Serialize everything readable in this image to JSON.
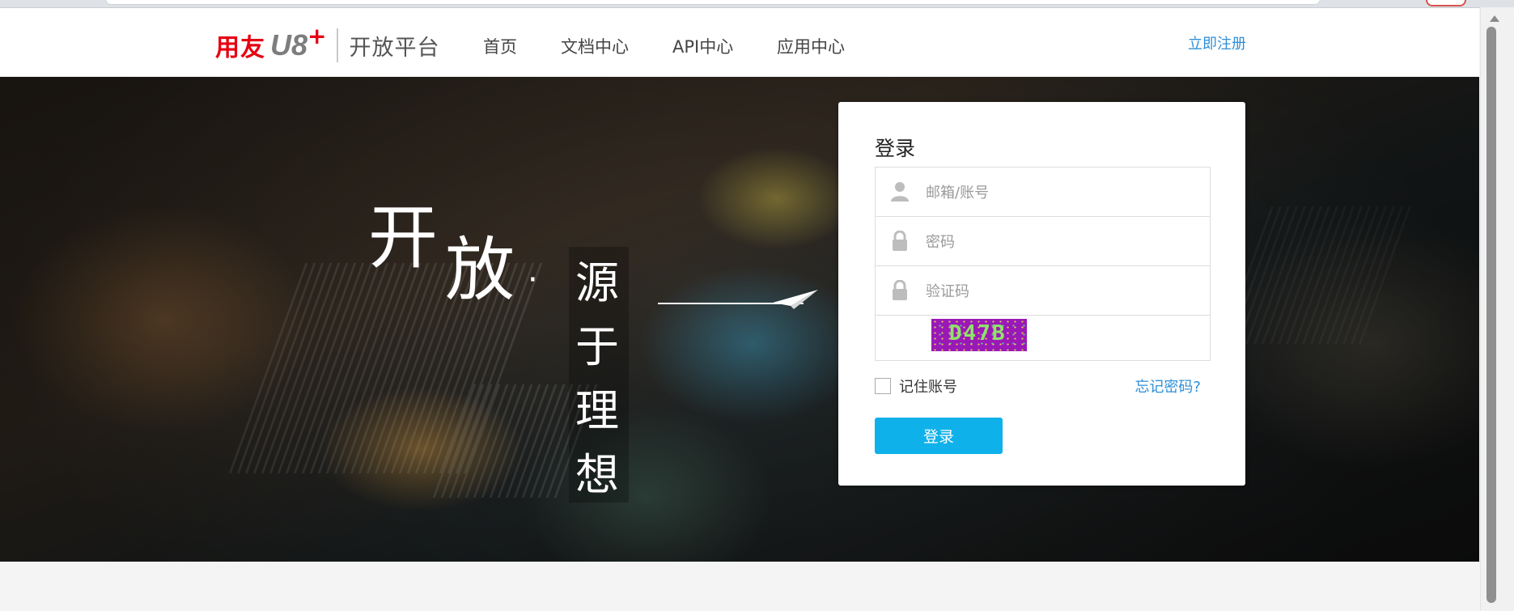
{
  "header": {
    "brand": "用友",
    "product": "U8",
    "product_plus": "+",
    "platform": "开放平台",
    "nav": [
      "首页",
      "文档中心",
      "API中心",
      "应用中心"
    ],
    "register": "立即注册"
  },
  "hero": {
    "slogan_big_1": "开",
    "slogan_big_2": "放",
    "slogan_dot": "·",
    "slogan_sub": "源于理想"
  },
  "login": {
    "title": "登录",
    "account_placeholder": "邮箱/账号",
    "password_placeholder": "密码",
    "captcha_placeholder": "验证码",
    "captcha_text": "D47B",
    "remember_label": "记住账号",
    "remember_checked": false,
    "forgot_link": "忘记密码?",
    "submit_label": "登录"
  },
  "colors": {
    "brand_red": "#e60012",
    "link_blue": "#2e8fd8",
    "button_blue": "#0fb1ea",
    "captcha_bg": "#9b18b8",
    "captcha_text": "#8fe36a"
  },
  "icons": [
    "user-icon",
    "lock-icon",
    "plane-icon"
  ]
}
